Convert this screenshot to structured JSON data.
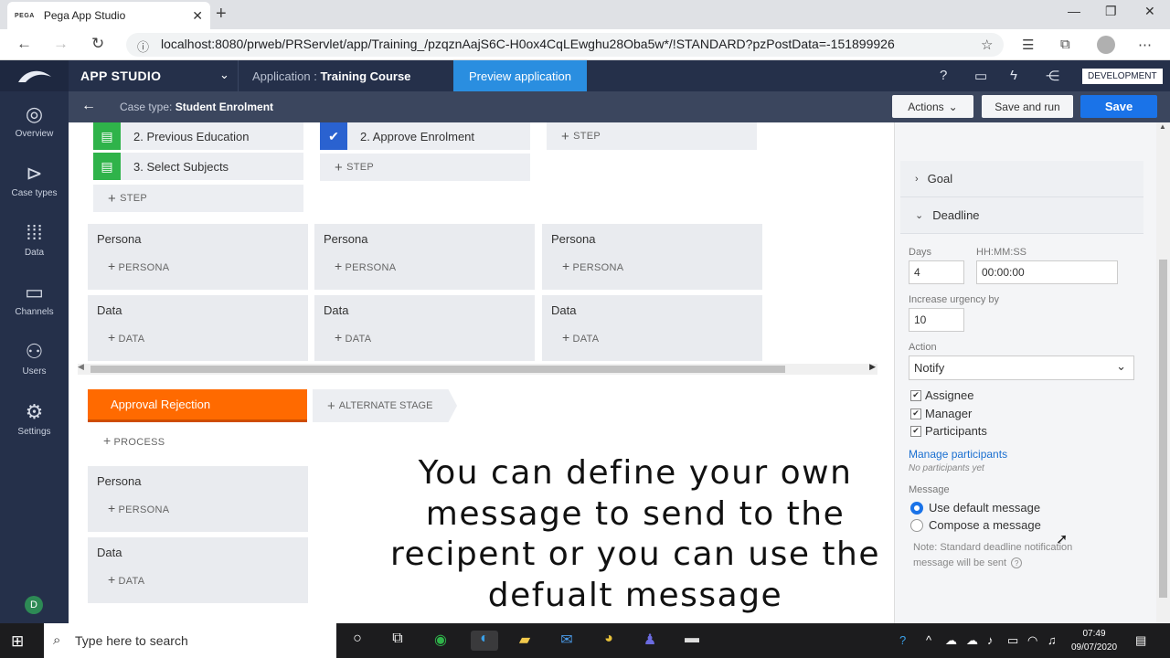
{
  "browser": {
    "tab_title": "Pega App Studio",
    "tab_favicon": "PEGA",
    "url": "localhost:8080/prweb/PRServlet/app/Training_/pzqznAajS6C-H0ox4CqLEwghu28Oba5w*/!STANDARD?pzPostData=-151899926"
  },
  "header": {
    "app_studio": "APP STUDIO",
    "application_label": "Application :",
    "application_name": "Training Course",
    "preview_button": "Preview application",
    "environment_badge": "DEVELOPMENT"
  },
  "leftnav": {
    "items": [
      {
        "label": "Overview",
        "icon": "overview-icon"
      },
      {
        "label": "Case types",
        "icon": "case-types-icon"
      },
      {
        "label": "Data",
        "icon": "data-icon"
      },
      {
        "label": "Channels",
        "icon": "channels-icon"
      },
      {
        "label": "Users",
        "icon": "users-icon"
      },
      {
        "label": "Settings",
        "icon": "settings-icon"
      }
    ],
    "user_initial": "D"
  },
  "casebar": {
    "label": "Case type:",
    "value": "Student Enrolment",
    "actions_button": "Actions",
    "save_run_button": "Save and run",
    "save_button": "Save"
  },
  "canvas": {
    "steps": {
      "s1": "2.  Previous Education",
      "s2": "3.  Select Subjects",
      "s3": "2.  Approve Enrolment"
    },
    "step_add": "STEP",
    "persona_heading": "Persona",
    "persona_add": "PERSONA",
    "data_heading": "Data",
    "data_add": "DATA",
    "stage_name": "Approval Rejection",
    "alternate_stage": "ALTERNATE STAGE",
    "process_add": "PROCESS"
  },
  "subtitle": "You can define your own message to send to the recipent or you can use the defualt message",
  "rightpanel": {
    "goal": "Goal",
    "deadline": "Deadline",
    "days_label": "Days",
    "days_value": "4",
    "time_label": "HH:MM:SS",
    "time_value": "00:00:00",
    "urgency_label": "Increase urgency by",
    "urgency_value": "10",
    "action_label": "Action",
    "action_value": "Notify",
    "assignee": "Assignee",
    "manager": "Manager",
    "participants": "Participants",
    "manage_participants": "Manage participants",
    "no_participants": "No participants yet",
    "message_label": "Message",
    "use_default": "Use default message",
    "compose": "Compose a message",
    "note": "Note: Standard deadline notification message will be sent"
  },
  "taskbar": {
    "search_placeholder": "Type here to search",
    "time": "07:49",
    "date": "09/07/2020"
  },
  "colors": {
    "nav_bg": "#25304a",
    "accent_blue": "#1a73e8",
    "preview_blue": "#2a8ee0",
    "stage_orange": "#ff6a00",
    "step_green": "#2fb34a",
    "step_blue": "#2a62d0"
  }
}
